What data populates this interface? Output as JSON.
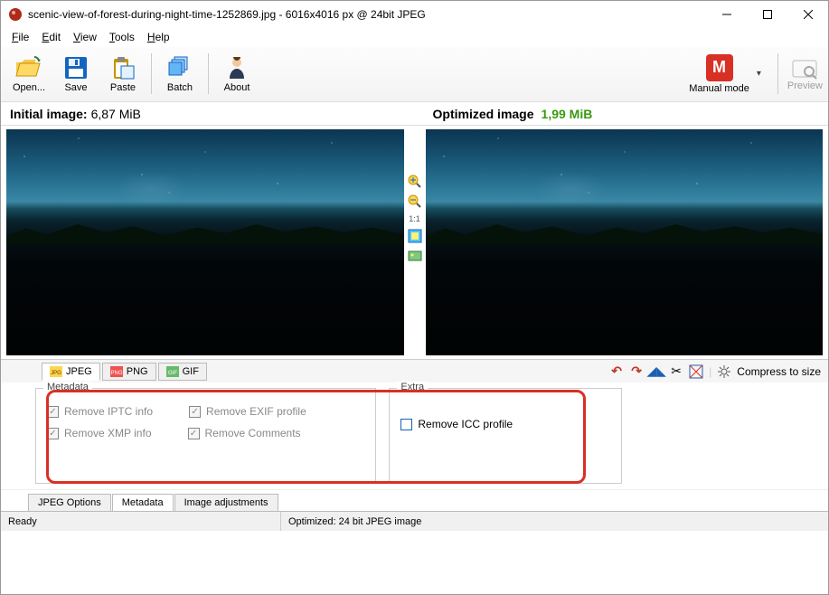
{
  "window": {
    "title": "scenic-view-of-forest-during-night-time-1252869.jpg - 6016x4016 px @ 24bit JPEG"
  },
  "menu": [
    "File",
    "Edit",
    "View",
    "Tools",
    "Help"
  ],
  "toolbar": {
    "open": "Open...",
    "save": "Save",
    "paste": "Paste",
    "batch": "Batch",
    "about": "About",
    "mode": "Manual mode",
    "mode_letter": "M",
    "preview": "Preview"
  },
  "info": {
    "initial_label": "Initial image:",
    "initial_value": "6,87 MiB",
    "optimized_label": "Optimized image",
    "optimized_value": "1,99 MiB"
  },
  "center": {
    "ratio": "1:1"
  },
  "formats": {
    "jpeg": "JPEG",
    "png": "PNG",
    "gif": "GIF"
  },
  "action_bar": {
    "compress": "Compress to size"
  },
  "opts": {
    "metadata_legend": "Metadata",
    "extra_legend": "Extra",
    "iptc": "Remove IPTC info",
    "exif": "Remove EXIF profile",
    "xmp": "Remove XMP info",
    "comments": "Remove Comments",
    "icc": "Remove ICC profile"
  },
  "tabs": {
    "jpeg_options": "JPEG Options",
    "metadata": "Metadata",
    "image_adj": "Image adjustments"
  },
  "status": {
    "ready": "Ready",
    "optimized": "Optimized: 24 bit JPEG image"
  }
}
